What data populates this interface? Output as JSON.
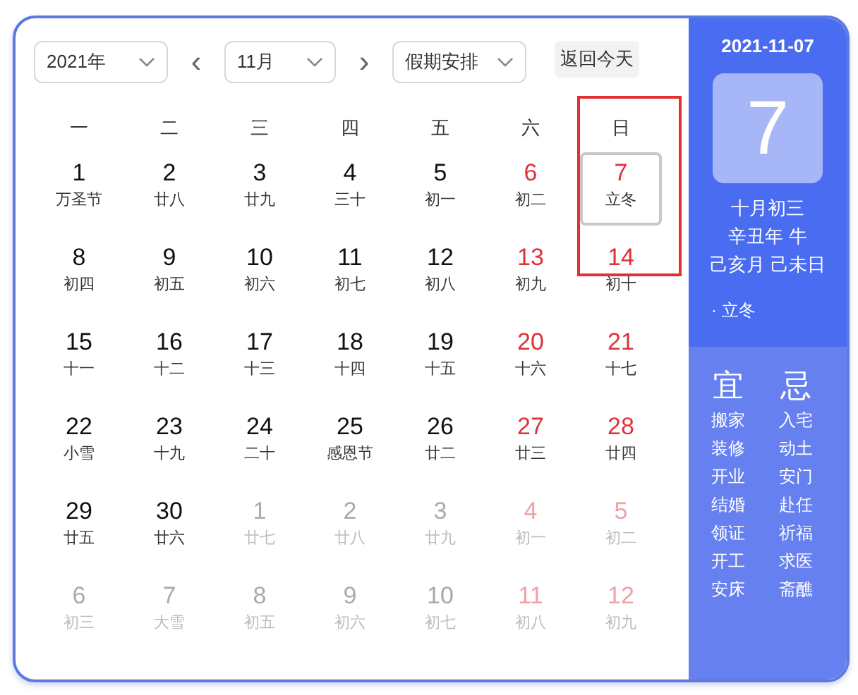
{
  "toolbar": {
    "year": "2021年",
    "prev": "‹",
    "month": "11月",
    "next": "›",
    "holiday": "假期安排",
    "today_button": "返回今天"
  },
  "weekdays": [
    {
      "label": "一",
      "highlighted": false
    },
    {
      "label": "二",
      "highlighted": false
    },
    {
      "label": "三",
      "highlighted": false
    },
    {
      "label": "四",
      "highlighted": false
    },
    {
      "label": "五",
      "highlighted": false
    },
    {
      "label": "六",
      "highlighted": false
    },
    {
      "label": "日",
      "highlighted": true
    }
  ],
  "days": [
    {
      "day": "1",
      "lunar": "万圣节",
      "in_month": true,
      "weekend": false,
      "selected": false
    },
    {
      "day": "2",
      "lunar": "廿八",
      "in_month": true,
      "weekend": false,
      "selected": false
    },
    {
      "day": "3",
      "lunar": "廿九",
      "in_month": true,
      "weekend": false,
      "selected": false
    },
    {
      "day": "4",
      "lunar": "三十",
      "in_month": true,
      "weekend": false,
      "selected": false
    },
    {
      "day": "5",
      "lunar": "初一",
      "in_month": true,
      "weekend": false,
      "selected": false
    },
    {
      "day": "6",
      "lunar": "初二",
      "in_month": true,
      "weekend": true,
      "selected": false
    },
    {
      "day": "7",
      "lunar": "立冬",
      "in_month": true,
      "weekend": true,
      "selected": true
    },
    {
      "day": "8",
      "lunar": "初四",
      "in_month": true,
      "weekend": false,
      "selected": false
    },
    {
      "day": "9",
      "lunar": "初五",
      "in_month": true,
      "weekend": false,
      "selected": false
    },
    {
      "day": "10",
      "lunar": "初六",
      "in_month": true,
      "weekend": false,
      "selected": false
    },
    {
      "day": "11",
      "lunar": "初七",
      "in_month": true,
      "weekend": false,
      "selected": false
    },
    {
      "day": "12",
      "lunar": "初八",
      "in_month": true,
      "weekend": false,
      "selected": false
    },
    {
      "day": "13",
      "lunar": "初九",
      "in_month": true,
      "weekend": true,
      "selected": false
    },
    {
      "day": "14",
      "lunar": "初十",
      "in_month": true,
      "weekend": true,
      "selected": false
    },
    {
      "day": "15",
      "lunar": "十一",
      "in_month": true,
      "weekend": false,
      "selected": false
    },
    {
      "day": "16",
      "lunar": "十二",
      "in_month": true,
      "weekend": false,
      "selected": false
    },
    {
      "day": "17",
      "lunar": "十三",
      "in_month": true,
      "weekend": false,
      "selected": false
    },
    {
      "day": "18",
      "lunar": "十四",
      "in_month": true,
      "weekend": false,
      "selected": false
    },
    {
      "day": "19",
      "lunar": "十五",
      "in_month": true,
      "weekend": false,
      "selected": false
    },
    {
      "day": "20",
      "lunar": "十六",
      "in_month": true,
      "weekend": true,
      "selected": false
    },
    {
      "day": "21",
      "lunar": "十七",
      "in_month": true,
      "weekend": true,
      "selected": false
    },
    {
      "day": "22",
      "lunar": "小雪",
      "in_month": true,
      "weekend": false,
      "selected": false
    },
    {
      "day": "23",
      "lunar": "十九",
      "in_month": true,
      "weekend": false,
      "selected": false
    },
    {
      "day": "24",
      "lunar": "二十",
      "in_month": true,
      "weekend": false,
      "selected": false
    },
    {
      "day": "25",
      "lunar": "感恩节",
      "in_month": true,
      "weekend": false,
      "selected": false
    },
    {
      "day": "26",
      "lunar": "廿二",
      "in_month": true,
      "weekend": false,
      "selected": false
    },
    {
      "day": "27",
      "lunar": "廿三",
      "in_month": true,
      "weekend": true,
      "selected": false
    },
    {
      "day": "28",
      "lunar": "廿四",
      "in_month": true,
      "weekend": true,
      "selected": false
    },
    {
      "day": "29",
      "lunar": "廿五",
      "in_month": true,
      "weekend": false,
      "selected": false
    },
    {
      "day": "30",
      "lunar": "廿六",
      "in_month": true,
      "weekend": false,
      "selected": false
    },
    {
      "day": "1",
      "lunar": "廿七",
      "in_month": false,
      "weekend": false,
      "selected": false
    },
    {
      "day": "2",
      "lunar": "廿八",
      "in_month": false,
      "weekend": false,
      "selected": false
    },
    {
      "day": "3",
      "lunar": "廿九",
      "in_month": false,
      "weekend": false,
      "selected": false
    },
    {
      "day": "4",
      "lunar": "初一",
      "in_month": false,
      "weekend": true,
      "selected": false
    },
    {
      "day": "5",
      "lunar": "初二",
      "in_month": false,
      "weekend": true,
      "selected": false
    },
    {
      "day": "6",
      "lunar": "初三",
      "in_month": false,
      "weekend": false,
      "selected": false
    },
    {
      "day": "7",
      "lunar": "大雪",
      "in_month": false,
      "weekend": false,
      "selected": false
    },
    {
      "day": "8",
      "lunar": "初五",
      "in_month": false,
      "weekend": false,
      "selected": false
    },
    {
      "day": "9",
      "lunar": "初六",
      "in_month": false,
      "weekend": false,
      "selected": false
    },
    {
      "day": "10",
      "lunar": "初七",
      "in_month": false,
      "weekend": false,
      "selected": false
    },
    {
      "day": "11",
      "lunar": "初八",
      "in_month": false,
      "weekend": true,
      "selected": false
    },
    {
      "day": "12",
      "lunar": "初九",
      "in_month": false,
      "weekend": true,
      "selected": false
    }
  ],
  "detail": {
    "date": "2021-11-07",
    "big_day": "7",
    "lines": [
      "十月初三",
      "辛丑年 牛",
      "己亥月 己未日"
    ],
    "term": "· 立冬"
  },
  "almanac": {
    "good_title": "宜",
    "good": [
      "搬家",
      "装修",
      "开业",
      "结婚",
      "领证",
      "开工",
      "安床"
    ],
    "bad_title": "忌",
    "bad": [
      "入宅",
      "动土",
      "安门",
      "赴任",
      "祈福",
      "求医",
      "斋醮"
    ]
  }
}
